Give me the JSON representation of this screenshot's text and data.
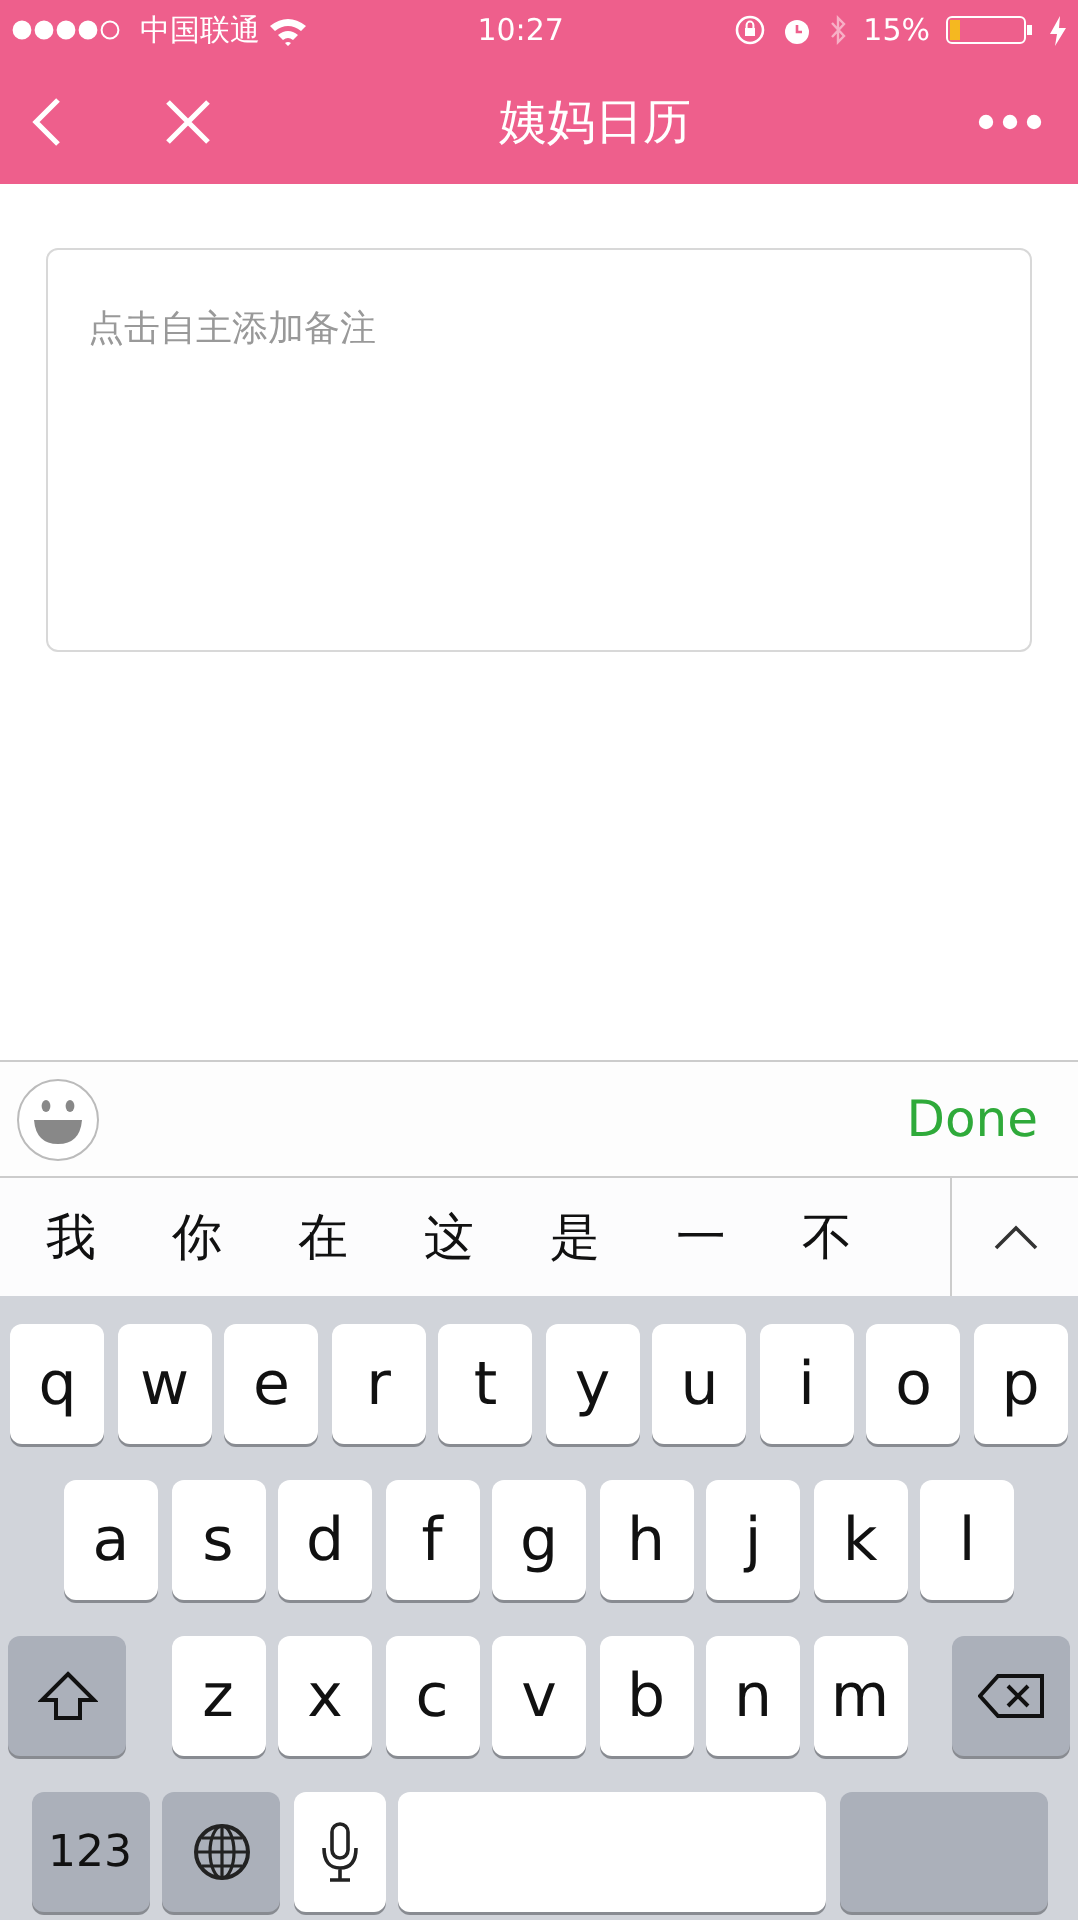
{
  "status_bar": {
    "carrier": "中国联通",
    "time": "10:27",
    "battery_percent": "15%",
    "battery": {
      "level": 0.15
    }
  },
  "nav_bar": {
    "title": "姨妈日历"
  },
  "note": {
    "placeholder": "点击自主添加备注"
  },
  "toolbar": {
    "done": "Done"
  },
  "candidates": [
    "我",
    "你",
    "在",
    "这",
    "是",
    "一",
    "不"
  ],
  "keyboard": {
    "rows": [
      [
        {
          "kind": "letter",
          "label": "q"
        },
        {
          "kind": "letter",
          "label": "w"
        },
        {
          "kind": "letter",
          "label": "e"
        },
        {
          "kind": "letter",
          "label": "r"
        },
        {
          "kind": "letter",
          "label": "t"
        },
        {
          "kind": "letter",
          "label": "y"
        },
        {
          "kind": "letter",
          "label": "u"
        },
        {
          "kind": "letter",
          "label": "i"
        },
        {
          "kind": "letter",
          "label": "o"
        },
        {
          "kind": "letter",
          "label": "p"
        }
      ],
      [
        {
          "kind": "letter",
          "label": "a"
        },
        {
          "kind": "letter",
          "label": "s"
        },
        {
          "kind": "letter",
          "label": "d"
        },
        {
          "kind": "letter",
          "label": "f"
        },
        {
          "kind": "letter",
          "label": "g"
        },
        {
          "kind": "letter",
          "label": "h"
        },
        {
          "kind": "letter",
          "label": "j"
        },
        {
          "kind": "letter",
          "label": "k"
        },
        {
          "kind": "letter",
          "label": "l"
        }
      ],
      [
        {
          "kind": "shift"
        },
        {
          "kind": "letter",
          "label": "z"
        },
        {
          "kind": "letter",
          "label": "x"
        },
        {
          "kind": "letter",
          "label": "c"
        },
        {
          "kind": "letter",
          "label": "v"
        },
        {
          "kind": "letter",
          "label": "b"
        },
        {
          "kind": "letter",
          "label": "n"
        },
        {
          "kind": "letter",
          "label": "m"
        },
        {
          "kind": "delete"
        }
      ],
      [
        {
          "kind": "mode",
          "label": "123"
        },
        {
          "kind": "globe"
        },
        {
          "kind": "mic"
        },
        {
          "kind": "space"
        },
        {
          "kind": "return"
        }
      ]
    ]
  }
}
